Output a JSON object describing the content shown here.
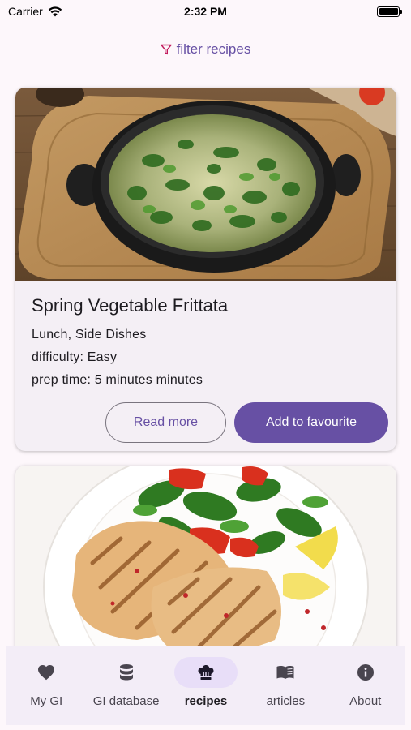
{
  "status_bar": {
    "carrier": "Carrier",
    "time": "2:32 PM"
  },
  "filter": {
    "label": "filter recipes",
    "icon": "filter-icon"
  },
  "recipes": [
    {
      "title": "Spring Vegetable Frittata",
      "category": "Lunch, Side Dishes",
      "difficulty": "difficulty: Easy",
      "prep_time": "prep time: 5 minutes minutes",
      "read_more_label": "Read more",
      "favourite_label": "Add to favourite"
    },
    {
      "title": "",
      "category": ""
    }
  ],
  "bottom_nav": {
    "items": [
      {
        "label": "My GI",
        "icon": "heart-icon"
      },
      {
        "label": "GI database",
        "icon": "database-icon"
      },
      {
        "label": "recipes",
        "icon": "chef-hat-icon",
        "active": true
      },
      {
        "label": "articles",
        "icon": "book-icon"
      },
      {
        "label": "About",
        "icon": "info-icon"
      }
    ]
  },
  "colors": {
    "accent": "#6750a4",
    "background": "#fdf7fb",
    "card": "#f4eff5",
    "nav_background": "#f3edf7",
    "nav_active_pill": "#e8def8"
  }
}
